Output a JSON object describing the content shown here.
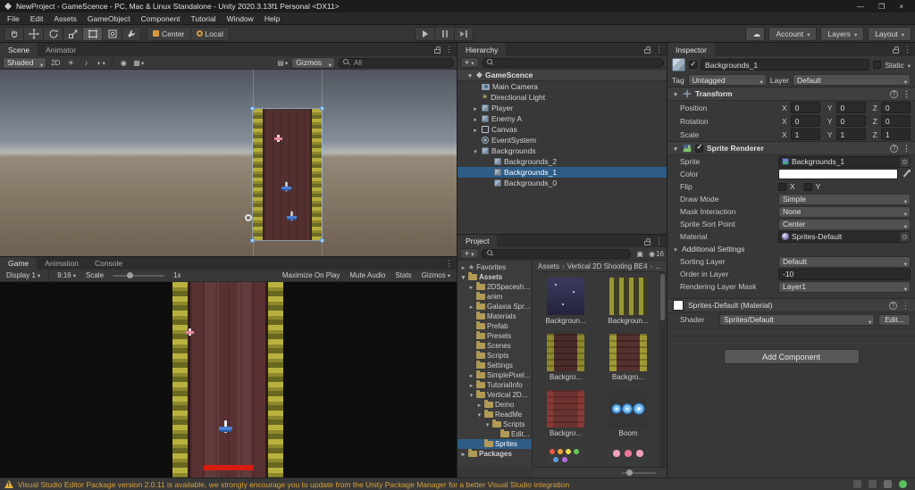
{
  "titlebar": {
    "title": "NewProject - GameScence - PC, Mac & Linux Standalone - Unity 2020.3.13f1 Personal <DX11>",
    "minimize": "—",
    "maximize": "❐",
    "close": "×"
  },
  "menubar": {
    "items": [
      "File",
      "Edit",
      "Assets",
      "GameObject",
      "Component",
      "Tutorial",
      "Window",
      "Help"
    ]
  },
  "toolbar": {
    "center": "Center",
    "local": "Local",
    "account": "Account",
    "layers": "Layers",
    "layout": "Layout"
  },
  "scene": {
    "tabs": [
      "Scene",
      "Animator"
    ],
    "shaded": "Shaded",
    "two_d": "2D",
    "gizmos": "Gizmos",
    "search_value": "All"
  },
  "game": {
    "tabs": [
      "Game",
      "Animation",
      "Console"
    ],
    "display": "Display 1",
    "aspect": "9:16",
    "scale_label": "Scale",
    "scale_value": "1x",
    "maximize_on_play": "Maximize On Play",
    "mute_audio": "Mute Audio",
    "stats": "Stats",
    "gizmos": "Gizmos"
  },
  "hierarchy": {
    "tab": "Hierarchy",
    "add": "+",
    "scene_root": "GameScence",
    "items": [
      {
        "label": "Main Camera"
      },
      {
        "label": "Directional Light"
      },
      {
        "label": "Player"
      },
      {
        "label": "Enemy A"
      },
      {
        "label": "Canvas"
      },
      {
        "label": "EventSystem"
      },
      {
        "label": "Backgrounds"
      },
      {
        "label": "Backgrounds_2"
      },
      {
        "label": "Backgrounds_1"
      },
      {
        "label": "Backgrounds_0"
      }
    ]
  },
  "project": {
    "tab": "Project",
    "add": "+",
    "hidden_count": "16",
    "breadcrumbs": [
      "Assets",
      "Vertical 2D Shooting BE4",
      "..."
    ],
    "folders": [
      {
        "label": "Favorites"
      },
      {
        "label": "Assets"
      },
      {
        "label": "2DSpacesh..."
      },
      {
        "label": "anim"
      },
      {
        "label": "Galaxia Spr..."
      },
      {
        "label": "Materials"
      },
      {
        "label": "Prefab"
      },
      {
        "label": "Presets"
      },
      {
        "label": "Scenes"
      },
      {
        "label": "Scripts"
      },
      {
        "label": "Settings"
      },
      {
        "label": "SimplePixel..."
      },
      {
        "label": "TutorialInfo"
      },
      {
        "label": "Vertical 2D..."
      },
      {
        "label": "Demo"
      },
      {
        "label": "ReadMe"
      },
      {
        "label": "Scripts"
      },
      {
        "label": "Edit..."
      },
      {
        "label": "Sprites"
      },
      {
        "label": "Packages"
      }
    ],
    "assets": [
      {
        "label": "Backgroun..."
      },
      {
        "label": "Backgroun..."
      },
      {
        "label": "Backgro..."
      },
      {
        "label": "Backgro..."
      },
      {
        "label": "Backgro..."
      },
      {
        "label": "Boom"
      }
    ]
  },
  "inspector": {
    "tab": "Inspector",
    "name": "Backgrounds_1",
    "static_label": "Static",
    "tag_label": "Tag",
    "tag_value": "Untagged",
    "layer_label": "Layer",
    "layer_value": "Default",
    "axis": {
      "x": "X",
      "y": "Y",
      "z": "Z"
    },
    "transform": {
      "title": "Transform",
      "rows": [
        {
          "label": "Position",
          "x": "0",
          "y": "0",
          "z": "0"
        },
        {
          "label": "Rotation",
          "x": "0",
          "y": "0",
          "z": "0"
        },
        {
          "label": "Scale",
          "x": "1",
          "y": "1",
          "z": "1"
        }
      ]
    },
    "sprite_renderer": {
      "title": "Sprite Renderer",
      "sprite_label": "Sprite",
      "sprite_value": "Backgrounds_1",
      "color_label": "Color",
      "flip_label": "Flip",
      "flip_x": "X",
      "flip_y": "Y",
      "draw_mode_label": "Draw Mode",
      "draw_mode_value": "Simple",
      "mask_label": "Mask Interaction",
      "mask_value": "None",
      "sort_point_label": "Sprite Sort Point",
      "sort_point_value": "Center",
      "material_label": "Material",
      "material_value": "Sprites-Default",
      "additional_label": "Additional Settings",
      "sorting_layer_label": "Sorting Layer",
      "sorting_layer_value": "Default",
      "order_label": "Order in Layer",
      "order_value": "-10",
      "render_mask_label": "Rendering Layer Mask",
      "render_mask_value": "Layer1"
    },
    "material": {
      "title": "Sprites-Default (Material)",
      "shader_label": "Shader",
      "shader_value": "Sprites/Default",
      "edit_button": "Edit..."
    },
    "add_component": "Add Component"
  },
  "statusbar": {
    "message": "Visual Studio Editor Package version 2.0.11 is available, we strongly encourage you to update from the Unity Package Manager for a better Visual Studio integration"
  },
  "colors": {
    "selection_blue": "#2d5c87",
    "warning_text": "#d9a23a",
    "pivot_orange": "#d89a3c"
  }
}
